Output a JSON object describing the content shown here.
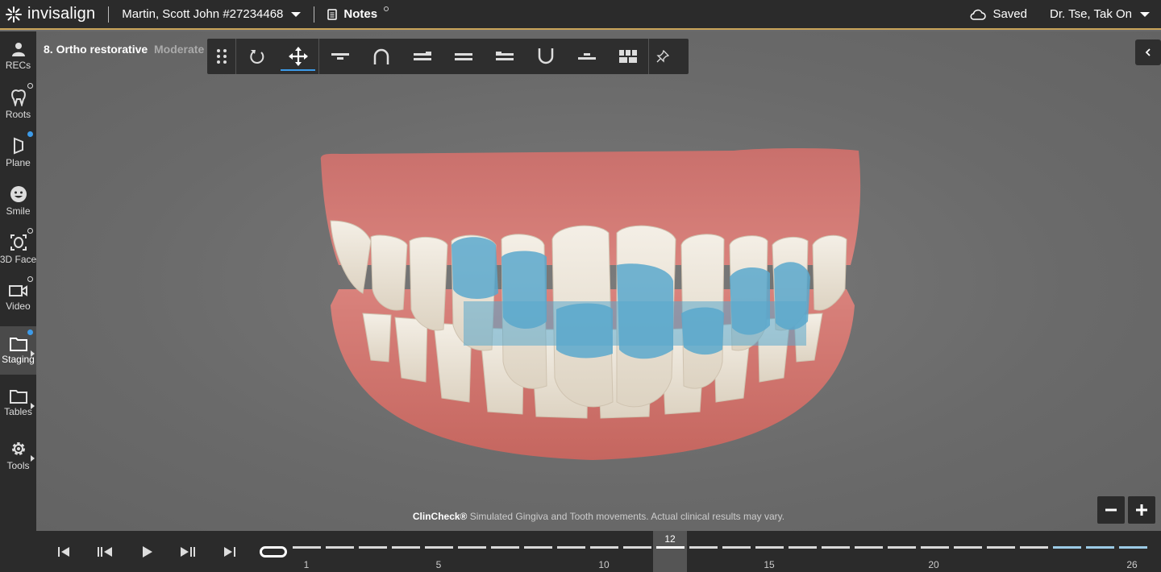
{
  "header": {
    "app_name": "invisalign",
    "patient": "Martin, Scott John #27234468",
    "notes_label": "Notes",
    "save_status": "Saved",
    "doctor": "Dr. Tse, Tak On",
    "accent_color": "#c9a45a"
  },
  "sidebar": {
    "items": [
      {
        "label": "RECs",
        "icon": "person-icon"
      },
      {
        "label": "Roots",
        "icon": "tooth-icon"
      },
      {
        "label": "Plane",
        "icon": "plane-icon"
      },
      {
        "label": "Smile",
        "icon": "smile-icon"
      },
      {
        "label": "3D Face",
        "icon": "face-scan-icon"
      },
      {
        "label": "Video",
        "icon": "video-icon"
      },
      {
        "label": "Staging",
        "icon": "folder-icon"
      },
      {
        "label": "Tables",
        "icon": "folder-icon"
      },
      {
        "label": "Tools",
        "icon": "gear-icon"
      }
    ]
  },
  "viewer": {
    "stage_title": "8. Ortho restorative",
    "stage_subtitle": "Moderate",
    "toolbar_tools": [
      "drag-handle-icon",
      "rotate-icon",
      "move-icon",
      "top-view-icon",
      "upper-arch-icon",
      "right-view-icon",
      "front-view-icon",
      "left-view-icon",
      "lower-arch-icon",
      "bottom-view-icon",
      "grid-view-icon",
      "pin-icon"
    ],
    "disclaimer_brand": "ClinCheck®",
    "disclaimer_text": " Simulated Gingiva and Tooth movements. Actual clinical results may vary.",
    "zoom_out": "−",
    "zoom_in": "+"
  },
  "timeline": {
    "current_stage": "12",
    "tick_labels": [
      "1",
      "5",
      "10",
      "15",
      "20",
      "26"
    ],
    "total_stages": 26,
    "current_index": 12,
    "highlight_start": 24,
    "segment_color": "#d9d9d9",
    "highlight_color": "#9ccbe6"
  }
}
